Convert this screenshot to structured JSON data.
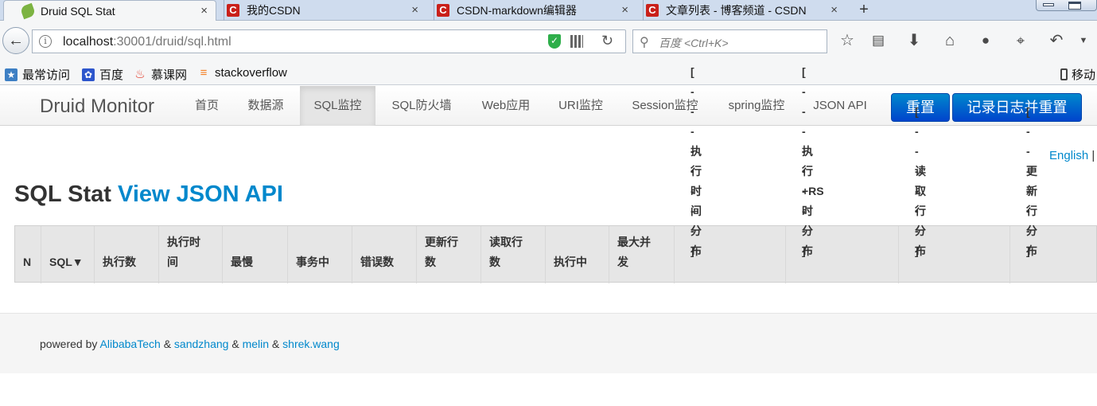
{
  "browser": {
    "tabs": [
      {
        "label": "Druid SQL Stat",
        "icon": "leaf-icon",
        "active": true
      },
      {
        "label": "我的CSDN",
        "icon": "csdn-icon",
        "active": false
      },
      {
        "label": "CSDN-markdown编辑器",
        "icon": "csdn-icon",
        "active": false
      },
      {
        "label": "文章列表 - 博客频道 - CSDN",
        "icon": "csdn-icon",
        "active": false
      }
    ],
    "tab_close_glyph": "×",
    "new_tab_glyph": "+",
    "url_host": "localhost",
    "url_rest": ":30001/druid/sql.html",
    "search_placeholder": "百度 <Ctrl+K>",
    "bookmarks": [
      {
        "label": "最常访问",
        "icon": "most-visited-icon"
      },
      {
        "label": "百度",
        "icon": "baidu-icon"
      },
      {
        "label": "慕课网",
        "icon": "imooc-icon"
      },
      {
        "label": "stackoverflow",
        "icon": "stackoverflow-icon"
      }
    ],
    "mobile_bookmarks": "移动"
  },
  "druid": {
    "brand": "Druid Monitor",
    "nav": [
      {
        "label": "首页"
      },
      {
        "label": "数据源"
      },
      {
        "label": "SQL监控",
        "active": true
      },
      {
        "label": "SQL防火墙"
      },
      {
        "label": "Web应用"
      },
      {
        "label": "URI监控"
      },
      {
        "label": "Session监控"
      },
      {
        "label": "spring监控"
      },
      {
        "label": "JSON API"
      }
    ],
    "reset_button": "重置",
    "log_reset_button": "记录日志并重置"
  },
  "main": {
    "lang_link": "English",
    "lang_sep": "|",
    "title": "SQL Stat",
    "title_link": "View JSON API",
    "table_headers": [
      {
        "label": "N"
      },
      {
        "label": "SQL▼"
      },
      {
        "label": "执行数"
      },
      {
        "label": "执行时\n间"
      },
      {
        "label": "最慢"
      },
      {
        "label": "事务中"
      },
      {
        "label": "错误数"
      },
      {
        "label": "更新行\n数"
      },
      {
        "label": "读取行\n数"
      },
      {
        "label": "执行中"
      },
      {
        "label": "最大并\n发"
      },
      {
        "label": "执行时间分布",
        "sub": "[ - - - - - - - - ]"
      },
      {
        "label": "执行+RS时分布",
        "sub": "[ - - - - - - - - ]"
      },
      {
        "label": "读取行分布",
        "sub": "[ - - - - - - ]"
      },
      {
        "label": "更新行分布",
        "sub": "[ - - - - - - ]"
      }
    ]
  },
  "footer": {
    "prefix": "powered by",
    "links": [
      "AlibabaTech",
      "sandzhang",
      "melin",
      "shrek.wang"
    ],
    "sep": "&"
  },
  "colors": {
    "accent": "#0088cc",
    "button_blue": "#0055cc",
    "csdn_red": "#c9201a"
  }
}
